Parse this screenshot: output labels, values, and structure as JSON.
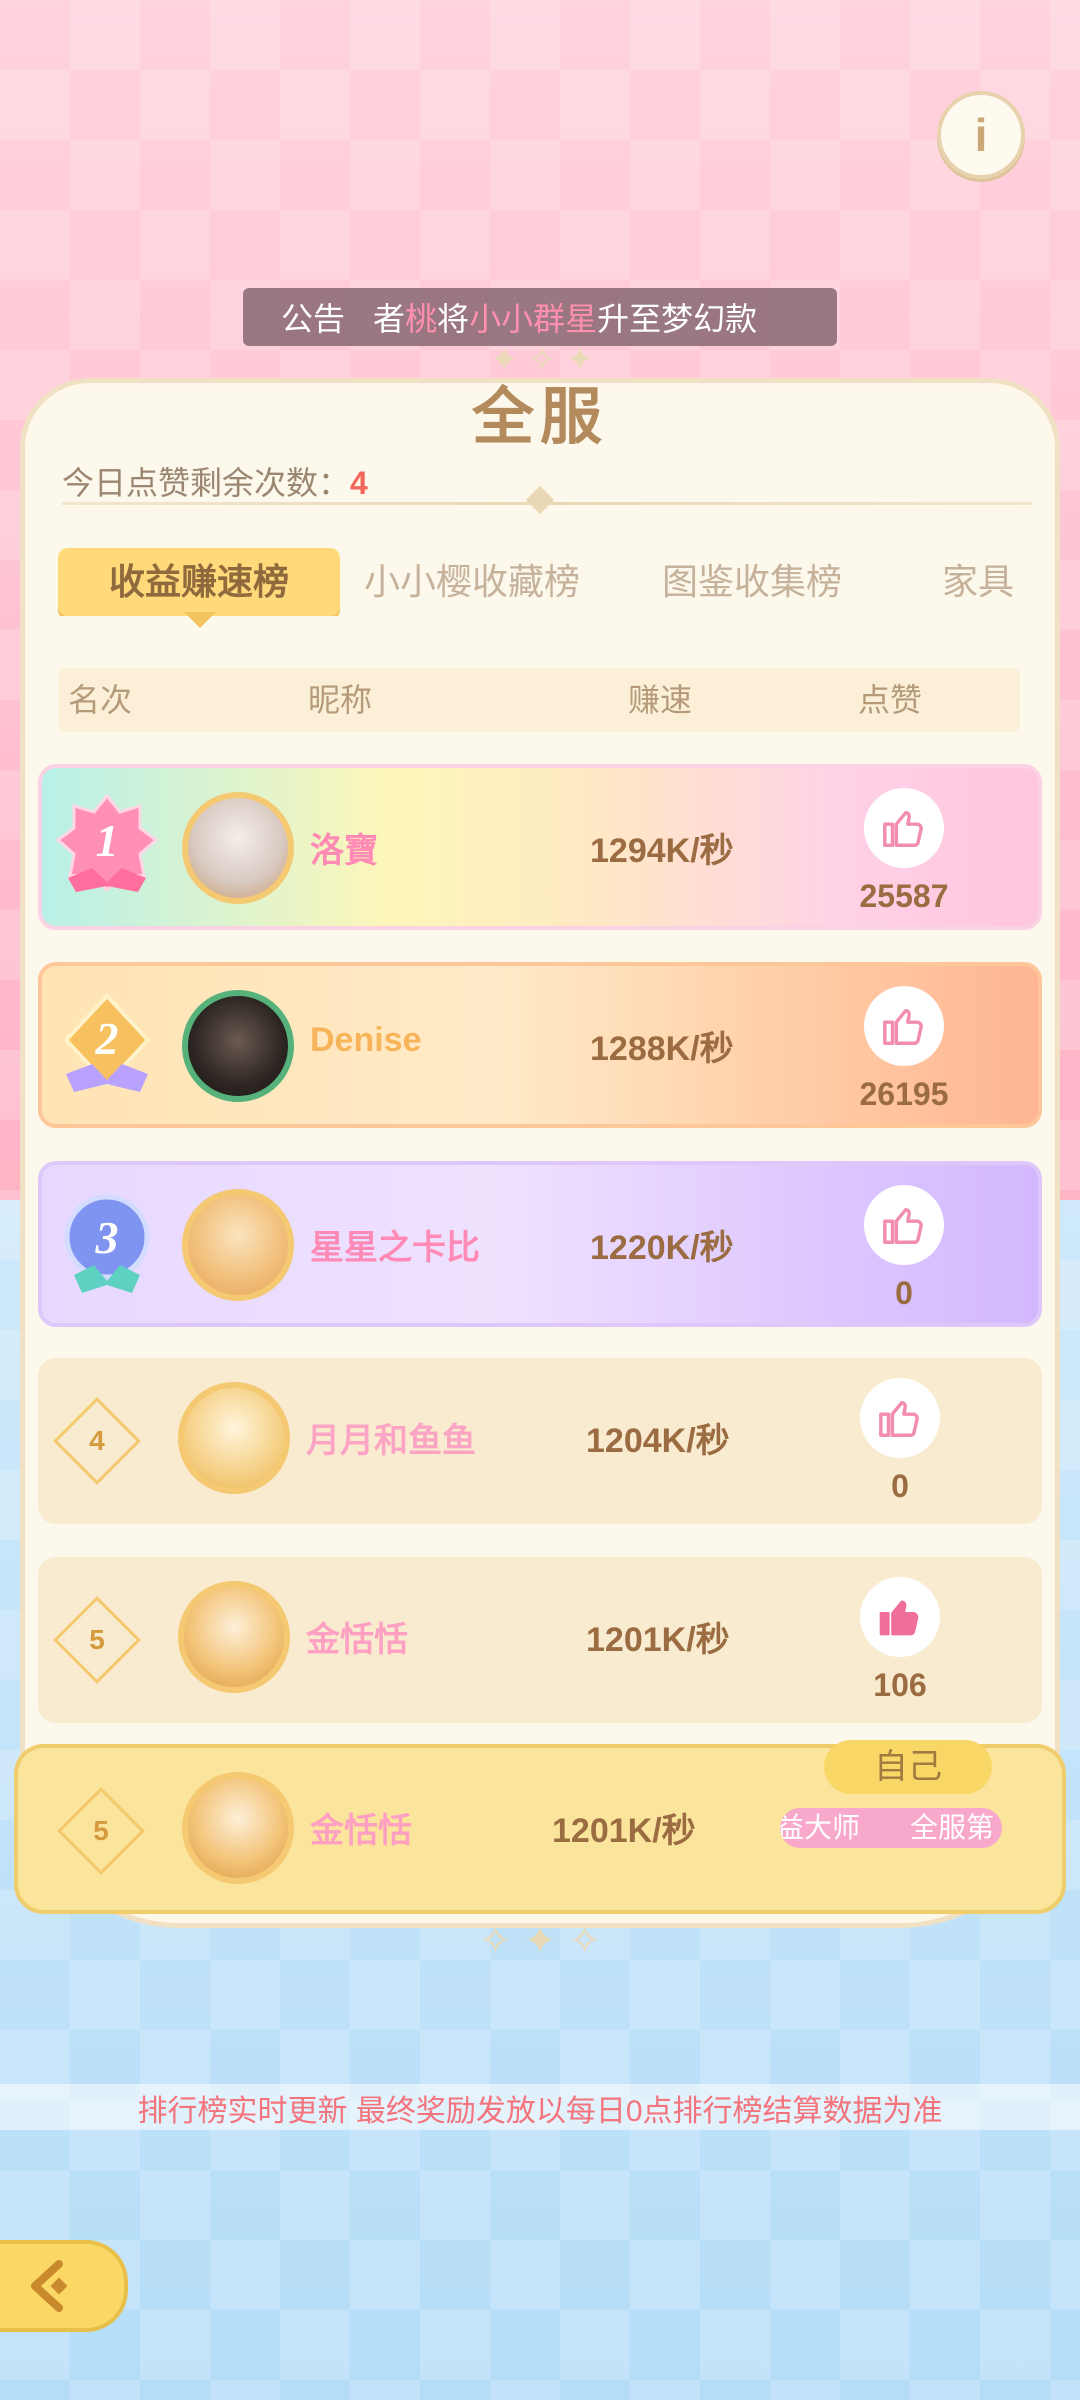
{
  "notice": {
    "label": "公告",
    "text_pre": "者",
    "text_hl1": "桃",
    "text_mid": "将",
    "text_hl2": "小小群星",
    "text_post": "升至梦幻款"
  },
  "info_icon": "info-icon",
  "panel": {
    "title": "全服",
    "remain_label": "今日点赞剩余次数：",
    "remain_count": "4"
  },
  "tabs": [
    {
      "label": "收益赚速榜",
      "active": true
    },
    {
      "label": "小小樱收藏榜",
      "active": false
    },
    {
      "label": "图鉴收集榜",
      "active": false
    },
    {
      "label": "家具",
      "active": false
    }
  ],
  "table_header": {
    "rank": "名次",
    "nickname": "昵称",
    "speed": "赚速",
    "like": "点赞"
  },
  "rows": [
    {
      "rank": "1",
      "name": "洛寶",
      "speed": "1294K/秒",
      "likes": "25587",
      "liked": false
    },
    {
      "rank": "2",
      "name": "Denise",
      "speed": "1288K/秒",
      "likes": "26195",
      "liked": false
    },
    {
      "rank": "3",
      "name": "星星之卡比",
      "speed": "1220K/秒",
      "likes": "0",
      "liked": false
    },
    {
      "rank": "4",
      "name": "月月和鱼鱼",
      "speed": "1204K/秒",
      "likes": "0",
      "liked": false
    },
    {
      "rank": "5",
      "name": "金恬恬",
      "speed": "1201K/秒",
      "likes": "106",
      "liked": true
    }
  ],
  "self_row": {
    "rank": "5",
    "name": "金恬恬",
    "speed": "1201K/秒",
    "tag": "自己",
    "badge1": "益大师",
    "badge2": "全服第"
  },
  "footnote": "排行榜实时更新 最终奖励发放以每日0点排行榜结算数据为准",
  "colors": {
    "accent_gold": "#ffd97a",
    "pink_text": "#ff8ab6",
    "brown_text": "#9b6b42",
    "title_brown": "#b28a5c",
    "remain_red": "#f3665c"
  }
}
